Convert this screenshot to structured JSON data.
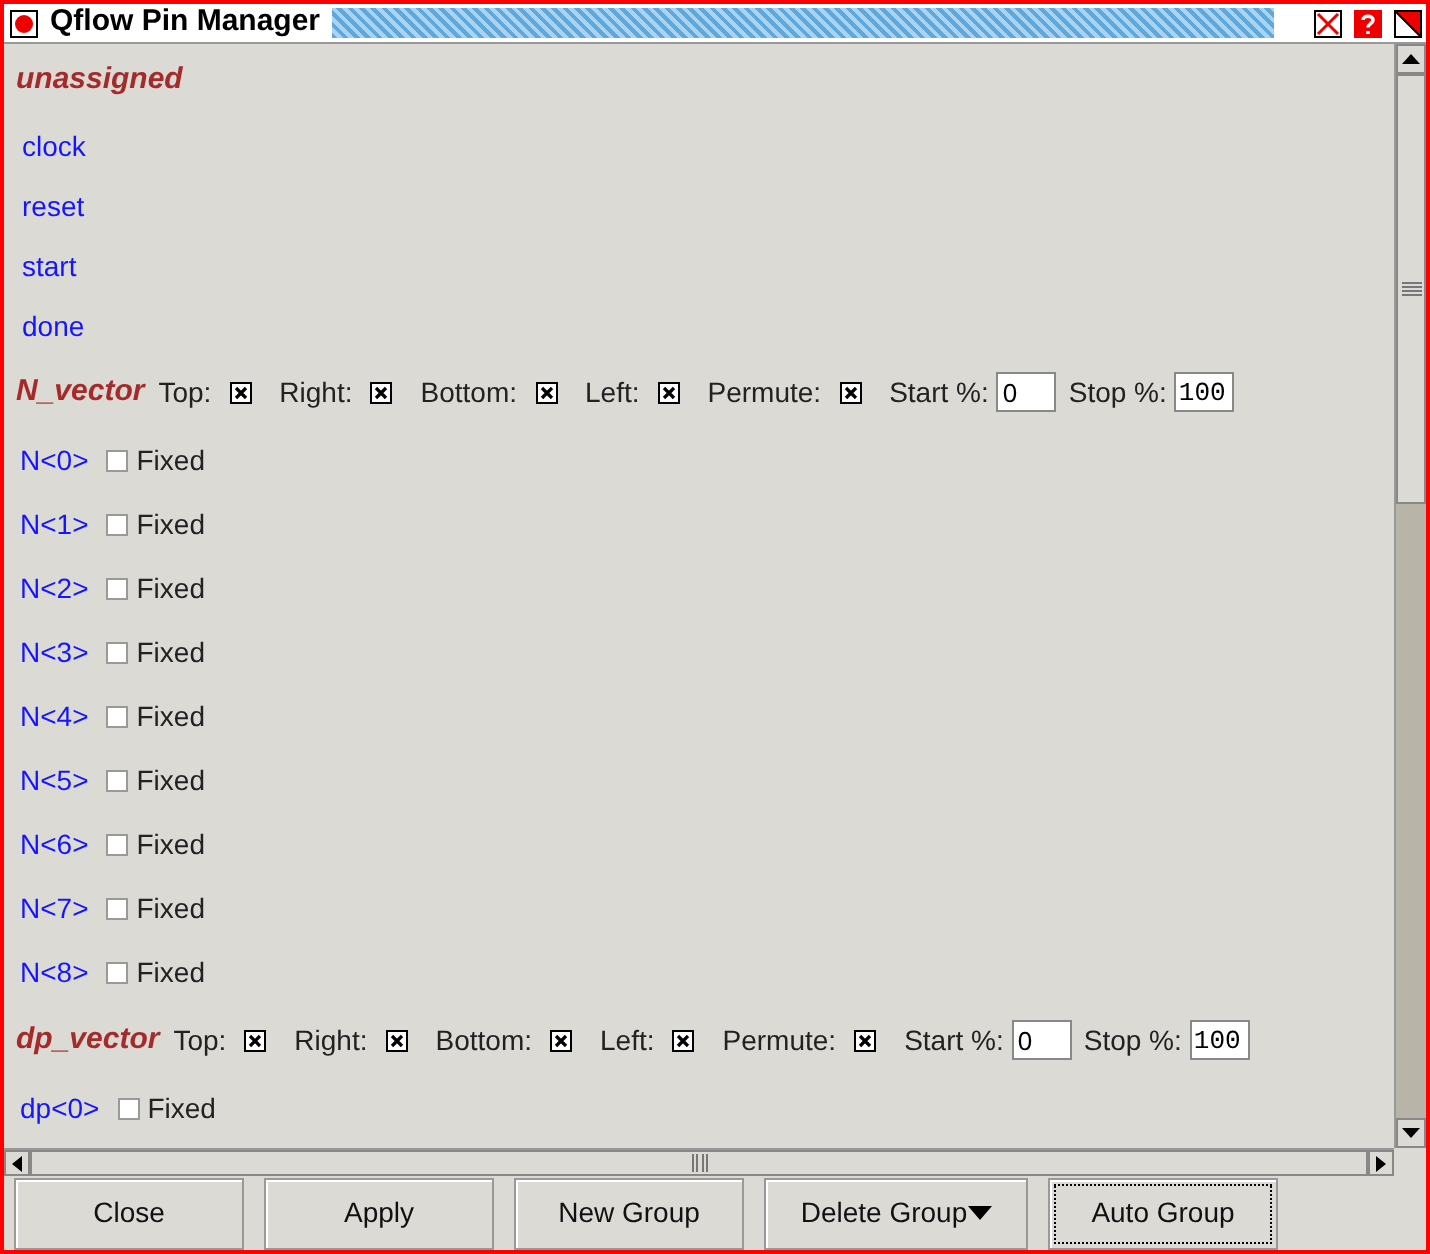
{
  "window": {
    "title": "Qflow Pin Manager"
  },
  "items": [
    {
      "kind": "group_label",
      "text": "unassigned"
    },
    {
      "kind": "pin",
      "name": "clock"
    },
    {
      "kind": "pin",
      "name": "reset"
    },
    {
      "kind": "pin",
      "name": "start"
    },
    {
      "kind": "pin",
      "name": "done"
    },
    {
      "kind": "vector",
      "name": "N_vector",
      "sides": [
        {
          "label": "Top:",
          "checked": true
        },
        {
          "label": "Right:",
          "checked": true
        },
        {
          "label": "Bottom:",
          "checked": true
        },
        {
          "label": "Left:",
          "checked": true
        },
        {
          "label": "Permute:",
          "checked": true
        }
      ],
      "start_label": "Start %:",
      "start": "0",
      "stop_label": "Stop %:",
      "stop": "100"
    },
    {
      "kind": "indexed_pin",
      "name": "N<0>",
      "fixed_label": "Fixed",
      "fixed": false
    },
    {
      "kind": "indexed_pin",
      "name": "N<1>",
      "fixed_label": "Fixed",
      "fixed": false
    },
    {
      "kind": "indexed_pin",
      "name": "N<2>",
      "fixed_label": "Fixed",
      "fixed": false
    },
    {
      "kind": "indexed_pin",
      "name": "N<3>",
      "fixed_label": "Fixed",
      "fixed": false
    },
    {
      "kind": "indexed_pin",
      "name": "N<4>",
      "fixed_label": "Fixed",
      "fixed": false
    },
    {
      "kind": "indexed_pin",
      "name": "N<5>",
      "fixed_label": "Fixed",
      "fixed": false
    },
    {
      "kind": "indexed_pin",
      "name": "N<6>",
      "fixed_label": "Fixed",
      "fixed": false
    },
    {
      "kind": "indexed_pin",
      "name": "N<7>",
      "fixed_label": "Fixed",
      "fixed": false
    },
    {
      "kind": "indexed_pin",
      "name": "N<8>",
      "fixed_label": "Fixed",
      "fixed": false
    },
    {
      "kind": "vector",
      "name": "dp_vector",
      "sides": [
        {
          "label": "Top:",
          "checked": true
        },
        {
          "label": "Right:",
          "checked": true
        },
        {
          "label": "Bottom:",
          "checked": true
        },
        {
          "label": "Left:",
          "checked": true
        },
        {
          "label": "Permute:",
          "checked": true
        }
      ],
      "start_label": "Start %:",
      "start": "0",
      "stop_label": "Stop %:",
      "stop": "100"
    },
    {
      "kind": "indexed_pin",
      "name": "dp<0>",
      "fixed_label": "Fixed",
      "fixed": false
    }
  ],
  "buttons": [
    {
      "label": "Close",
      "kind": "plain",
      "focused": false
    },
    {
      "label": "Apply",
      "kind": "plain",
      "focused": false
    },
    {
      "label": "New Group",
      "kind": "plain",
      "focused": false
    },
    {
      "label": "Delete Group",
      "kind": "dropdown",
      "focused": false
    },
    {
      "label": "Auto Group",
      "kind": "plain",
      "focused": true
    }
  ]
}
